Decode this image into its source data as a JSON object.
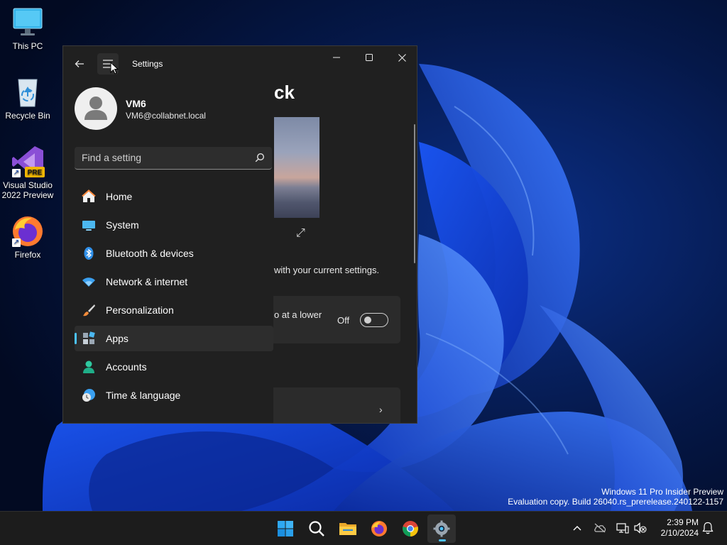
{
  "desktop": {
    "icons": [
      {
        "label": "This PC",
        "icon": "monitor-icon"
      },
      {
        "label": "Recycle Bin",
        "icon": "recycle-bin-icon"
      },
      {
        "label": "Visual Studio 2022 Preview",
        "icon": "visual-studio-icon",
        "badge": "PRE"
      },
      {
        "label": "Firefox",
        "icon": "firefox-icon"
      }
    ]
  },
  "settings": {
    "title": "Settings",
    "page_heading_fragment": "ck",
    "hint_fragment": "with your current settings.",
    "card_fragment": "o at a lower",
    "toggle": {
      "label": "Off",
      "state": false
    },
    "profile": {
      "name": "VM6",
      "email": "VM6@collabnet.local"
    },
    "search": {
      "placeholder": "Find a setting"
    },
    "nav": [
      {
        "label": "Home",
        "icon": "home-icon"
      },
      {
        "label": "System",
        "icon": "system-icon"
      },
      {
        "label": "Bluetooth & devices",
        "icon": "bluetooth-icon"
      },
      {
        "label": "Network & internet",
        "icon": "wifi-icon"
      },
      {
        "label": "Personalization",
        "icon": "brush-icon"
      },
      {
        "label": "Apps",
        "icon": "apps-icon",
        "selected": true
      },
      {
        "label": "Accounts",
        "icon": "accounts-icon"
      },
      {
        "label": "Time & language",
        "icon": "time-language-icon"
      }
    ]
  },
  "watermark": {
    "line1": "Windows 11 Pro Insider Preview",
    "line2": "Evaluation copy. Build 26040.rs_prerelease.240122-1157"
  },
  "taskbar": {
    "apps": [
      "start-icon",
      "search-icon",
      "file-explorer-icon",
      "firefox-icon",
      "chrome-icon",
      "settings-icon"
    ],
    "active_app": "settings-icon",
    "clock": {
      "time": "2:39 PM",
      "date": "2/10/2024"
    }
  },
  "colors": {
    "accent": "#4cc2ff",
    "window_bg": "#202020",
    "taskbar_bg": "#1c1c1c"
  }
}
